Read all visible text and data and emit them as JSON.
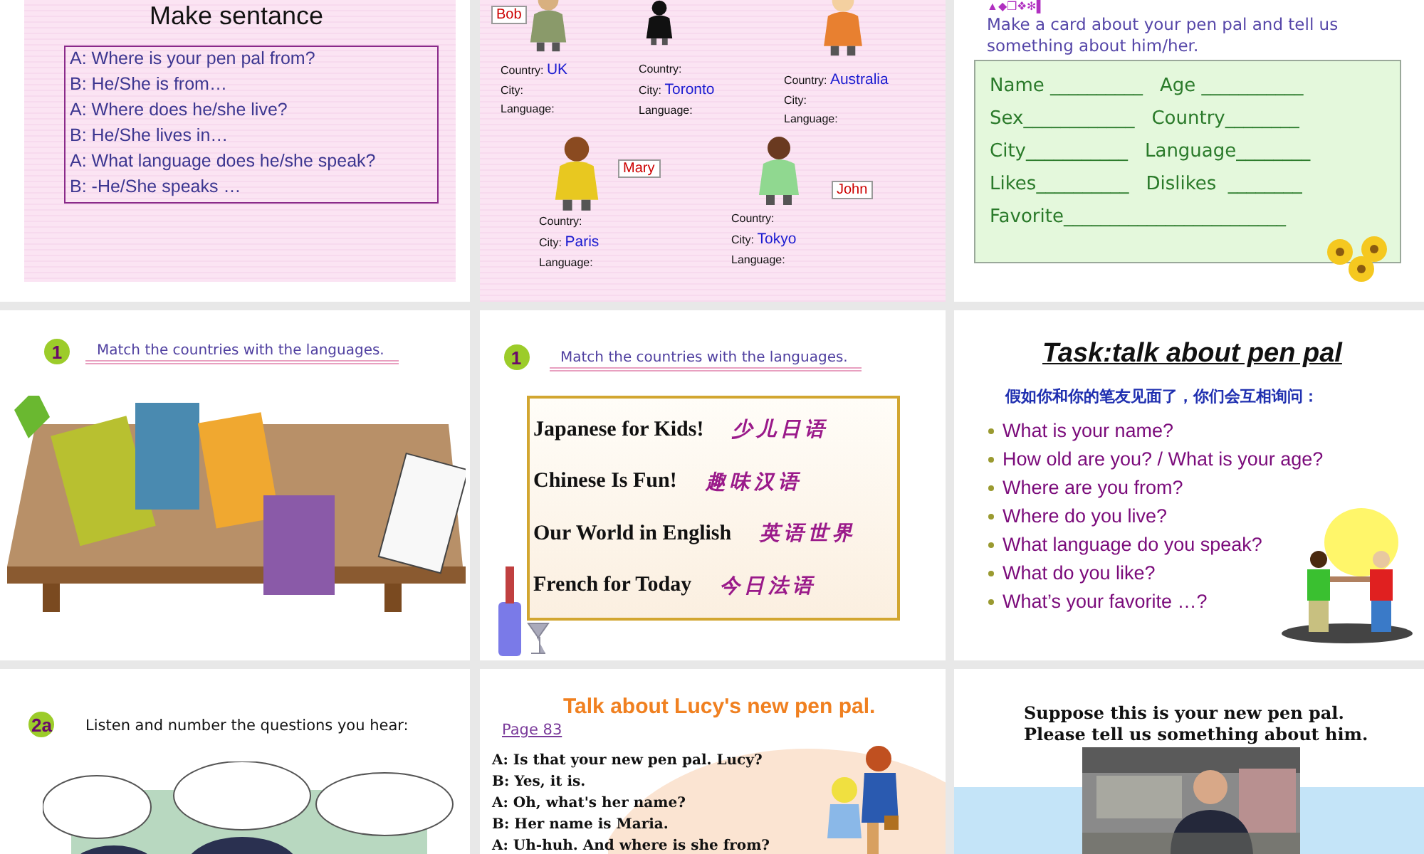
{
  "slides": [
    {
      "kind": "sentences",
      "title": "Make sentance",
      "lines": [
        "A: Where is your pen pal from?",
        "B: He/She is from…",
        "A: Where does he/she live?",
        "B: He/She lives in…",
        "A: What language does he/she speak?",
        "B: -He/She speaks …"
      ]
    },
    {
      "kind": "pen_pals",
      "pals": [
        {
          "name": "Bob",
          "fields": [
            {
              "label": "Country:",
              "value": "UK"
            },
            {
              "label": "City:"
            },
            {
              "label": "Language:"
            }
          ]
        },
        {
          "fields": [
            {
              "label": "Country:"
            },
            {
              "label": "City:",
              "value": "Toronto"
            },
            {
              "label": "Language:"
            }
          ]
        },
        {
          "fields": [
            {
              "label": "Country:",
              "value": "Australia"
            },
            {
              "label": "City:"
            },
            {
              "label": "Language:"
            }
          ]
        },
        {
          "name": "Mary",
          "fields": [
            {
              "label": "Country:"
            },
            {
              "label": "City:",
              "value": "Paris"
            },
            {
              "label": "Language:"
            }
          ]
        },
        {
          "name": "John",
          "fields": [
            {
              "label": "Country:"
            },
            {
              "label": "City:",
              "value": "Tokyo"
            },
            {
              "label": "Language:"
            }
          ]
        }
      ]
    },
    {
      "kind": "card",
      "symbols": "▲◆❒❖✻▌",
      "intro": "Make a card about your pen pal and tell us something about him/her.",
      "rows": [
        [
          "Name __________",
          "Age ___________"
        ],
        [
          "Sex____________",
          "Country________"
        ],
        [
          "City___________",
          "Language________"
        ],
        [
          "Likes__________",
          "Dislikes  ________"
        ],
        [
          "Favorite________________________"
        ]
      ]
    },
    {
      "kind": "matching_picture",
      "number": "1",
      "instruction": "Match the countries with the languages."
    },
    {
      "kind": "book_list",
      "number": "1",
      "instruction": "Match the countries with the languages.",
      "books": [
        {
          "title": "Japanese for Kids!",
          "chinese": "少儿日语"
        },
        {
          "title": "Chinese Is Fun!",
          "chinese": "趣味汉语"
        },
        {
          "title": "Our World in English",
          "chinese": "英语世界"
        },
        {
          "title": "French for Today",
          "chinese": "今日法语"
        }
      ]
    },
    {
      "kind": "questions",
      "title": "Task:talk about pen pal",
      "prompt": "假如你和你的笔友见面了，你们会互相询问：",
      "questions": [
        "What is your name?",
        "How old are you? / What is your age?",
        "Where are you from?",
        "Where do you live?",
        "What language do you speak?",
        "What do you like?",
        "What’s your favorite …?"
      ]
    },
    {
      "kind": "listening",
      "number": "2a",
      "instruction": "Listen and number the questions you hear:"
    },
    {
      "kind": "dialogue",
      "title": "Talk about Lucy's new pen pal.",
      "link": "Page 83",
      "lines": [
        "A: Is that your new pen pal. Lucy?",
        "B: Yes, it is.",
        "A: Oh, what's her name?",
        "B: Her name is Maria.",
        "A: Uh-huh. And where is she from?"
      ]
    },
    {
      "kind": "photo_prompt",
      "lines": [
        "Suppose this is your new pen pal.",
        "Please tell us something about him."
      ]
    }
  ]
}
